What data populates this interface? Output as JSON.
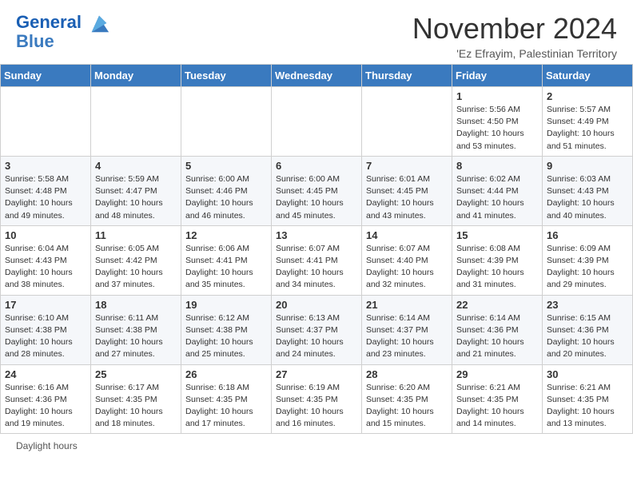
{
  "logo": {
    "line1": "General",
    "line2": "Blue"
  },
  "title": "November 2024",
  "location": "'Ez Efrayim, Palestinian Territory",
  "columns": [
    "Sunday",
    "Monday",
    "Tuesday",
    "Wednesday",
    "Thursday",
    "Friday",
    "Saturday"
  ],
  "footer": "Daylight hours",
  "weeks": [
    [
      {
        "day": "",
        "info": ""
      },
      {
        "day": "",
        "info": ""
      },
      {
        "day": "",
        "info": ""
      },
      {
        "day": "",
        "info": ""
      },
      {
        "day": "",
        "info": ""
      },
      {
        "day": "1",
        "info": "Sunrise: 5:56 AM\nSunset: 4:50 PM\nDaylight: 10 hours\nand 53 minutes."
      },
      {
        "day": "2",
        "info": "Sunrise: 5:57 AM\nSunset: 4:49 PM\nDaylight: 10 hours\nand 51 minutes."
      }
    ],
    [
      {
        "day": "3",
        "info": "Sunrise: 5:58 AM\nSunset: 4:48 PM\nDaylight: 10 hours\nand 49 minutes."
      },
      {
        "day": "4",
        "info": "Sunrise: 5:59 AM\nSunset: 4:47 PM\nDaylight: 10 hours\nand 48 minutes."
      },
      {
        "day": "5",
        "info": "Sunrise: 6:00 AM\nSunset: 4:46 PM\nDaylight: 10 hours\nand 46 minutes."
      },
      {
        "day": "6",
        "info": "Sunrise: 6:00 AM\nSunset: 4:45 PM\nDaylight: 10 hours\nand 45 minutes."
      },
      {
        "day": "7",
        "info": "Sunrise: 6:01 AM\nSunset: 4:45 PM\nDaylight: 10 hours\nand 43 minutes."
      },
      {
        "day": "8",
        "info": "Sunrise: 6:02 AM\nSunset: 4:44 PM\nDaylight: 10 hours\nand 41 minutes."
      },
      {
        "day": "9",
        "info": "Sunrise: 6:03 AM\nSunset: 4:43 PM\nDaylight: 10 hours\nand 40 minutes."
      }
    ],
    [
      {
        "day": "10",
        "info": "Sunrise: 6:04 AM\nSunset: 4:43 PM\nDaylight: 10 hours\nand 38 minutes."
      },
      {
        "day": "11",
        "info": "Sunrise: 6:05 AM\nSunset: 4:42 PM\nDaylight: 10 hours\nand 37 minutes."
      },
      {
        "day": "12",
        "info": "Sunrise: 6:06 AM\nSunset: 4:41 PM\nDaylight: 10 hours\nand 35 minutes."
      },
      {
        "day": "13",
        "info": "Sunrise: 6:07 AM\nSunset: 4:41 PM\nDaylight: 10 hours\nand 34 minutes."
      },
      {
        "day": "14",
        "info": "Sunrise: 6:07 AM\nSunset: 4:40 PM\nDaylight: 10 hours\nand 32 minutes."
      },
      {
        "day": "15",
        "info": "Sunrise: 6:08 AM\nSunset: 4:39 PM\nDaylight: 10 hours\nand 31 minutes."
      },
      {
        "day": "16",
        "info": "Sunrise: 6:09 AM\nSunset: 4:39 PM\nDaylight: 10 hours\nand 29 minutes."
      }
    ],
    [
      {
        "day": "17",
        "info": "Sunrise: 6:10 AM\nSunset: 4:38 PM\nDaylight: 10 hours\nand 28 minutes."
      },
      {
        "day": "18",
        "info": "Sunrise: 6:11 AM\nSunset: 4:38 PM\nDaylight: 10 hours\nand 27 minutes."
      },
      {
        "day": "19",
        "info": "Sunrise: 6:12 AM\nSunset: 4:38 PM\nDaylight: 10 hours\nand 25 minutes."
      },
      {
        "day": "20",
        "info": "Sunrise: 6:13 AM\nSunset: 4:37 PM\nDaylight: 10 hours\nand 24 minutes."
      },
      {
        "day": "21",
        "info": "Sunrise: 6:14 AM\nSunset: 4:37 PM\nDaylight: 10 hours\nand 23 minutes."
      },
      {
        "day": "22",
        "info": "Sunrise: 6:14 AM\nSunset: 4:36 PM\nDaylight: 10 hours\nand 21 minutes."
      },
      {
        "day": "23",
        "info": "Sunrise: 6:15 AM\nSunset: 4:36 PM\nDaylight: 10 hours\nand 20 minutes."
      }
    ],
    [
      {
        "day": "24",
        "info": "Sunrise: 6:16 AM\nSunset: 4:36 PM\nDaylight: 10 hours\nand 19 minutes."
      },
      {
        "day": "25",
        "info": "Sunrise: 6:17 AM\nSunset: 4:35 PM\nDaylight: 10 hours\nand 18 minutes."
      },
      {
        "day": "26",
        "info": "Sunrise: 6:18 AM\nSunset: 4:35 PM\nDaylight: 10 hours\nand 17 minutes."
      },
      {
        "day": "27",
        "info": "Sunrise: 6:19 AM\nSunset: 4:35 PM\nDaylight: 10 hours\nand 16 minutes."
      },
      {
        "day": "28",
        "info": "Sunrise: 6:20 AM\nSunset: 4:35 PM\nDaylight: 10 hours\nand 15 minutes."
      },
      {
        "day": "29",
        "info": "Sunrise: 6:21 AM\nSunset: 4:35 PM\nDaylight: 10 hours\nand 14 minutes."
      },
      {
        "day": "30",
        "info": "Sunrise: 6:21 AM\nSunset: 4:35 PM\nDaylight: 10 hours\nand 13 minutes."
      }
    ]
  ]
}
